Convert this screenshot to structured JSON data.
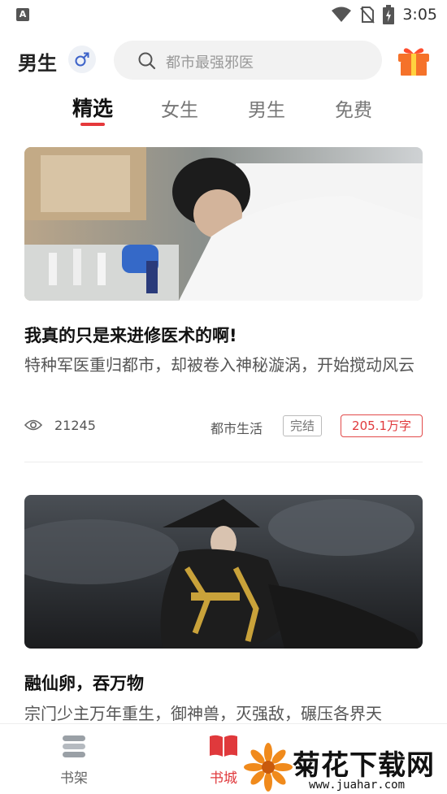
{
  "status_bar": {
    "app_badge": "A",
    "time": "3:05",
    "icons": [
      "wifi-icon",
      "no-sim-icon",
      "battery-charging-icon"
    ]
  },
  "header": {
    "gender_label": "男生",
    "gender_icon": "male-symbol-icon",
    "search_placeholder": "都市最强邪医",
    "gift_icon": "gift-icon"
  },
  "tabs": [
    {
      "label": "精选",
      "active": true
    },
    {
      "label": "女生",
      "active": false
    },
    {
      "label": "男生",
      "active": false
    },
    {
      "label": "免费",
      "active": false
    }
  ],
  "books": [
    {
      "title": "我真的只是来进修医术的啊!",
      "description": "特种军医重归都市，却被卷入神秘漩涡，开始搅动风云",
      "views": "21245",
      "category": "都市生活",
      "status": "完结",
      "word_count": "205.1万字"
    },
    {
      "title": "融仙卵，吞万物",
      "description": "宗门少主万年重生，御神兽，灭强敌，碾压各界天"
    }
  ],
  "bottom_nav": [
    {
      "label": "书架",
      "icon": "bookshelf-icon",
      "active": false
    },
    {
      "label": "书城",
      "icon": "open-book-icon",
      "active": true
    }
  ],
  "watermark": {
    "name": "菊花下载网",
    "url": "www.juahar.com"
  },
  "colors": {
    "accent": "#e0393c",
    "text_primary": "#111111",
    "text_secondary": "#555555",
    "search_bg": "#f2f2f2"
  }
}
